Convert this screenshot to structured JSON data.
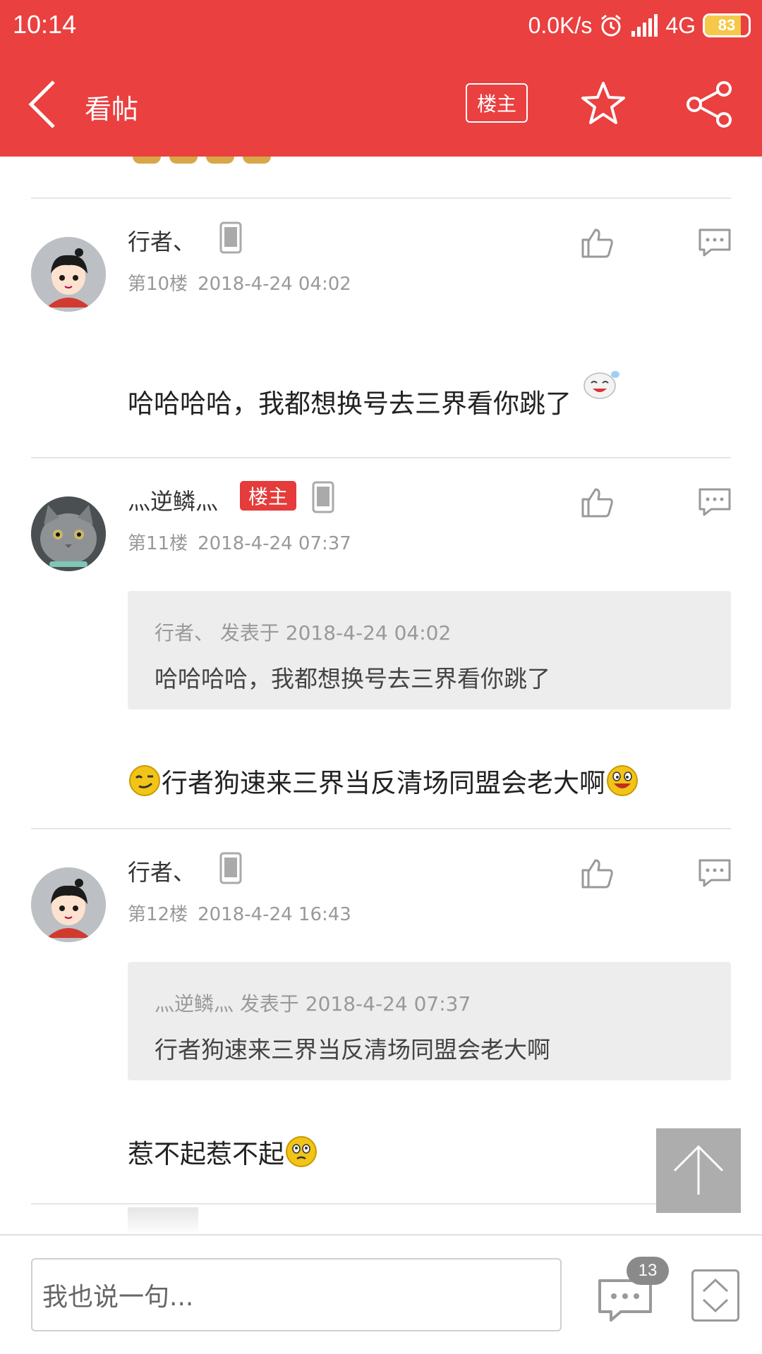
{
  "status_bar": {
    "time": "10:14",
    "speed": "0.0K/s",
    "network": "4G",
    "battery": "83",
    "battery_level": 0.83,
    "icons": [
      "alarm-icon",
      "signal-icon",
      "battery-icon"
    ]
  },
  "header": {
    "title": "看帖",
    "host_button": "楼主",
    "icons": [
      "back-icon",
      "star-icon",
      "share-icon"
    ],
    "background": "#ea4040"
  },
  "posts": [
    {
      "author": "行者、",
      "floor": "第10楼",
      "date": "2018-4-24 04:02",
      "body": "哈哈哈哈，我都想换号去三界看你跳了",
      "avatar": "cartoon-boy-avatar"
    },
    {
      "author": "灬逆鳞灬",
      "badge": "楼主",
      "floor": "第11楼",
      "date": "2018-4-24 07:37",
      "quote_meta": "行者、 发表于 2018-4-24 04:02",
      "quote_text": "哈哈哈哈，我都想换号去三界看你跳了",
      "body": "行者狗速来三界当反清场同盟会老大啊",
      "avatar": "gray-cat-avatar"
    },
    {
      "author": "行者、",
      "floor": "第12楼",
      "date": "2018-4-24 16:43",
      "quote_meta": "灬逆鳞灬 发表于 2018-4-24 07:37",
      "quote_text": "行者狗速来三界当反清场同盟会老大啊",
      "body": "惹不起惹不起",
      "avatar": "cartoon-boy-avatar"
    }
  ],
  "bottom_bar": {
    "input_placeholder": "我也说一句...",
    "comment_count": "13"
  },
  "colors": {
    "accent": "#ea4040",
    "badge": "#e53b3b",
    "quote_bg": "#ededed",
    "meta_text": "#999999"
  }
}
